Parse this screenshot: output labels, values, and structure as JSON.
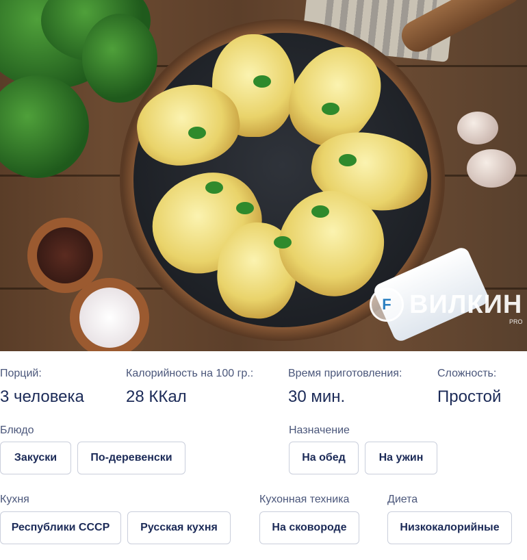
{
  "hero": {
    "watermark_brand": "ВИЛКИН",
    "watermark_pro": "PRO",
    "card_text": "Вилкин"
  },
  "stats": [
    {
      "label": "Порций:",
      "value": "3 человека"
    },
    {
      "label": "Калорийность на 100 гр.:",
      "value": "28 ККал"
    },
    {
      "label": "Время приготовления:",
      "value": "30 мин."
    },
    {
      "label": "Сложность:",
      "value": "Простой"
    }
  ],
  "dish": {
    "title": "Блюдо",
    "tags": [
      "Закуски",
      "По-деревенски"
    ]
  },
  "purpose": {
    "title": "Назначение",
    "tags": [
      "На обед",
      "На ужин"
    ]
  },
  "cuisine": {
    "title": "Кухня",
    "tags": [
      "Республики СССР",
      "Русская кухня"
    ]
  },
  "equipment": {
    "title": "Кухонная техника",
    "tags": [
      "На сковороде"
    ]
  },
  "diet": {
    "title": "Диета",
    "tags": [
      "Низкокалорийные"
    ]
  }
}
